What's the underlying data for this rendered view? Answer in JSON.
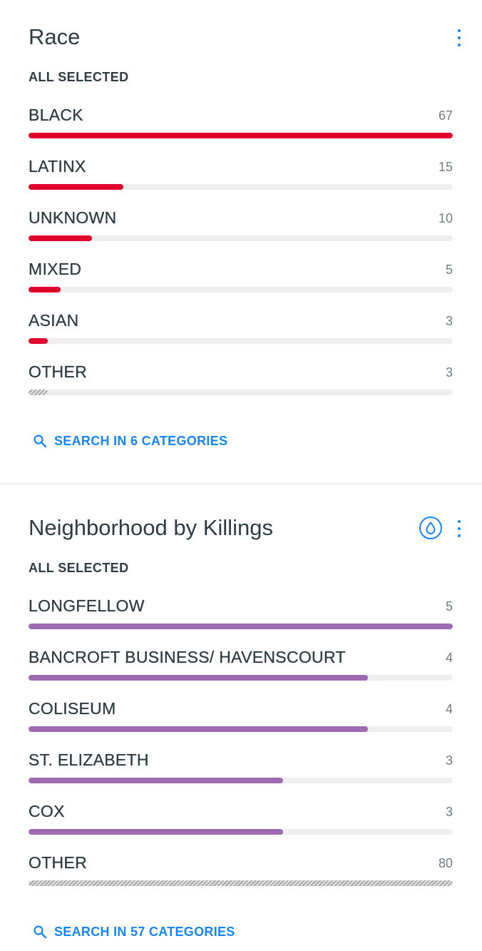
{
  "race": {
    "title": "Race",
    "subtitle": "ALL SELECTED",
    "search_label": "SEARCH IN 6 CATEGORIES",
    "bar_color": "#e1002d",
    "rows": [
      {
        "label": "BLACK",
        "count": "67",
        "fraction": 1.0
      },
      {
        "label": "LATINX",
        "count": "15",
        "fraction": 0.224
      },
      {
        "label": "UNKNOWN",
        "count": "10",
        "fraction": 0.149
      },
      {
        "label": "MIXED",
        "count": "5",
        "fraction": 0.075
      },
      {
        "label": "ASIAN",
        "count": "3",
        "fraction": 0.045
      },
      {
        "label": "OTHER",
        "count": "3",
        "fraction": 0.045,
        "other": true
      }
    ]
  },
  "neighborhood": {
    "title": "Neighborhood by Killings",
    "subtitle": "ALL SELECTED",
    "search_label": "SEARCH IN 57 CATEGORIES",
    "bar_color": "#9e6bb3",
    "rows": [
      {
        "label": "LONGFELLOW",
        "count": "5",
        "fraction": 1.0
      },
      {
        "label": "BANCROFT BUSINESS/ HAVENSCOURT",
        "count": "4",
        "fraction": 0.8
      },
      {
        "label": "COLISEUM",
        "count": "4",
        "fraction": 0.8
      },
      {
        "label": "ST. ELIZABETH",
        "count": "3",
        "fraction": 0.6
      },
      {
        "label": "COX",
        "count": "3",
        "fraction": 0.6
      },
      {
        "label": "OTHER",
        "count": "80",
        "fraction": 1.0,
        "other": true
      }
    ]
  },
  "icons": {
    "menu": "kebab-menu-icon",
    "search": "search-icon",
    "color_by": "droplet-icon"
  },
  "colors": {
    "accent": "#1785fb",
    "race_bar": "#e1002d",
    "neighborhood_bar": "#9e6bb3",
    "track": "#eeeeee"
  }
}
